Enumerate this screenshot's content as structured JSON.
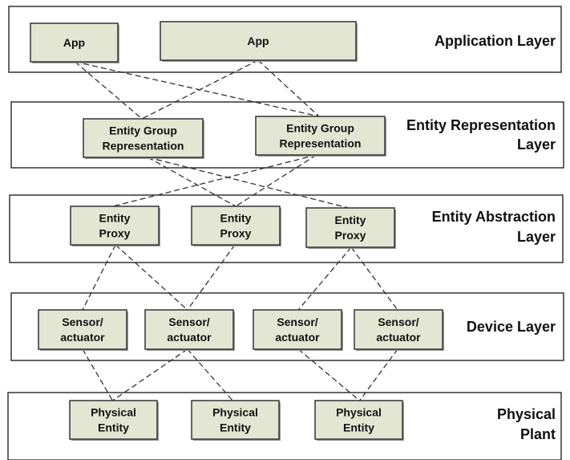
{
  "colors": {
    "node_fill": "#e3e6d2",
    "border": "#333333"
  },
  "layers": [
    {
      "id": "application",
      "label": [
        "Application Layer"
      ]
    },
    {
      "id": "representation",
      "label": [
        "Entity Representation",
        "Layer"
      ]
    },
    {
      "id": "abstraction",
      "label": [
        "Entity Abstraction",
        "Layer"
      ]
    },
    {
      "id": "device",
      "label": [
        "Device Layer"
      ]
    },
    {
      "id": "physical",
      "label": [
        "Physical",
        "Plant"
      ]
    }
  ],
  "nodes": [
    {
      "id": "app1",
      "layer": "application",
      "label": [
        "App"
      ]
    },
    {
      "id": "app2",
      "layer": "application",
      "label": [
        "App"
      ]
    },
    {
      "id": "egr1",
      "layer": "representation",
      "label": [
        "Entity Group",
        "Representation"
      ]
    },
    {
      "id": "egr2",
      "layer": "representation",
      "label": [
        "Entity Group",
        "Representation"
      ]
    },
    {
      "id": "ep1",
      "layer": "abstraction",
      "label": [
        "Entity",
        "Proxy"
      ]
    },
    {
      "id": "ep2",
      "layer": "abstraction",
      "label": [
        "Entity",
        "Proxy"
      ]
    },
    {
      "id": "ep3",
      "layer": "abstraction",
      "label": [
        "Entity",
        "Proxy"
      ]
    },
    {
      "id": "sa1",
      "layer": "device",
      "label": [
        "Sensor/",
        "actuator"
      ]
    },
    {
      "id": "sa2",
      "layer": "device",
      "label": [
        "Sensor/",
        "actuator"
      ]
    },
    {
      "id": "sa3",
      "layer": "device",
      "label": [
        "Sensor/",
        "actuator"
      ]
    },
    {
      "id": "sa4",
      "layer": "device",
      "label": [
        "Sensor/",
        "actuator"
      ]
    },
    {
      "id": "pe1",
      "layer": "physical",
      "label": [
        "Physical",
        "Entity"
      ]
    },
    {
      "id": "pe2",
      "layer": "physical",
      "label": [
        "Physical",
        "Entity"
      ]
    },
    {
      "id": "pe3",
      "layer": "physical",
      "label": [
        "Physical",
        "Entity"
      ]
    }
  ],
  "links": [
    [
      "app1",
      "egr1"
    ],
    [
      "app1",
      "egr2"
    ],
    [
      "app2",
      "egr1"
    ],
    [
      "app2",
      "egr2"
    ],
    [
      "egr1",
      "ep2"
    ],
    [
      "egr1",
      "ep3"
    ],
    [
      "egr2",
      "ep1"
    ],
    [
      "egr2",
      "ep2"
    ],
    [
      "ep1",
      "sa1"
    ],
    [
      "ep1",
      "sa2"
    ],
    [
      "ep2",
      "sa2"
    ],
    [
      "ep3",
      "sa3"
    ],
    [
      "ep3",
      "sa4"
    ],
    [
      "sa1",
      "pe1"
    ],
    [
      "sa2",
      "pe1"
    ],
    [
      "sa2",
      "pe2"
    ],
    [
      "sa3",
      "pe3"
    ],
    [
      "sa4",
      "pe3"
    ]
  ]
}
